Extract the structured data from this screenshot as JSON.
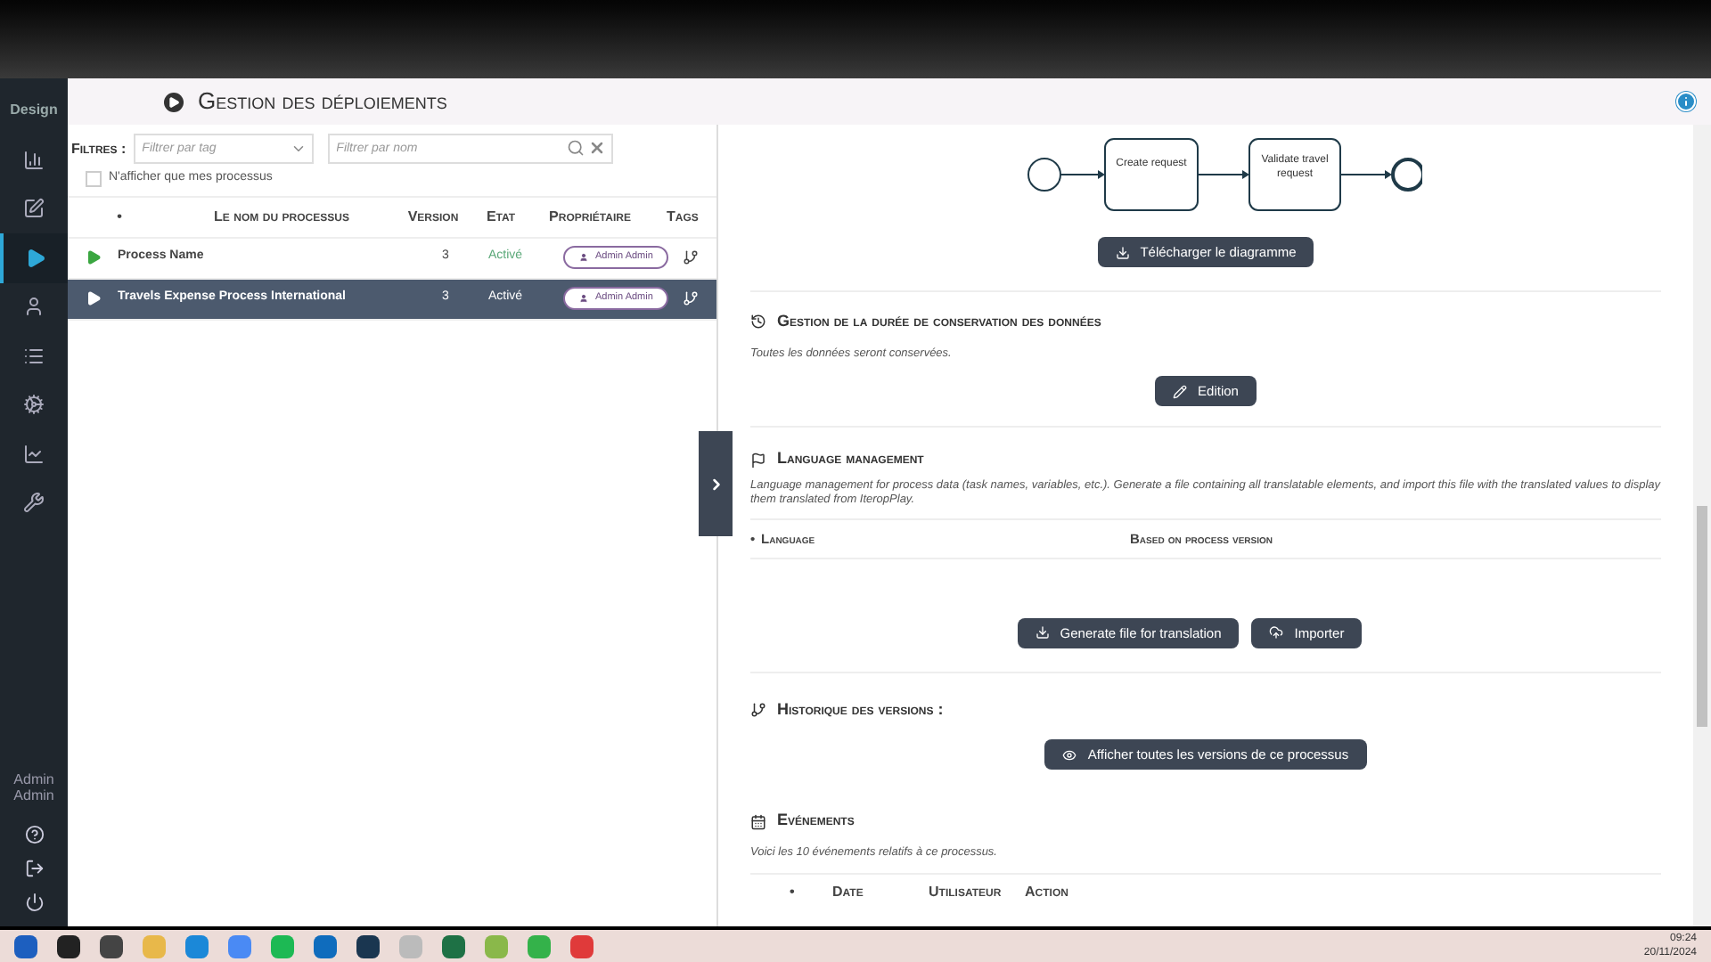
{
  "sidebar": {
    "brand": "Design",
    "items": [
      {
        "selected": false
      },
      {
        "selected": false
      },
      {
        "selected": true
      },
      {
        "selected": false
      },
      {
        "selected": false
      },
      {
        "selected": false
      },
      {
        "selected": false
      },
      {
        "selected": false
      }
    ],
    "user": "Admin Admin"
  },
  "header": {
    "title": "Gestion des déploiements"
  },
  "filters": {
    "label": "Filtres :",
    "tag_placeholder": "Filtrer par tag",
    "name_placeholder": "Filtrer par nom",
    "mine_only": {
      "label": "N'afficher que mes processus",
      "checked": false
    }
  },
  "table": {
    "columns": [
      "•",
      "Le nom du processus",
      "Version",
      "Etat",
      "Propriétaire",
      "Tags"
    ],
    "rows": [
      {
        "name": "Process Name",
        "version": "3",
        "state": "Activé",
        "owner": "Admin Admin",
        "selected": false
      },
      {
        "name": "Travels Expense Process International",
        "version": "3",
        "state": "Activé",
        "owner": "Admin Admin",
        "selected": true
      }
    ]
  },
  "diagram": {
    "tasks": [
      "Create request",
      "Validate travel request"
    ],
    "download_button": "Télécharger le diagramme"
  },
  "retention": {
    "title": "Gestion de la durée de conservation des données",
    "text": "Toutes les données seront conservées.",
    "button": "Edition"
  },
  "language": {
    "title": "Language management",
    "text": "Language management for process data (task names, variables, etc.). Generate a file containing all translatable elements, and import this file with the translated values to display them translated from IteropPlay.",
    "columns": [
      "•",
      "Language",
      "Based on process version"
    ],
    "buttons": [
      "Generate file for translation",
      "Importer"
    ]
  },
  "history": {
    "title": "Historique des versions :",
    "button": "Afficher toutes les versions de ce processus"
  },
  "events": {
    "title": "Evénements",
    "text": "Voici les 10 événements relatifs à ce processus.",
    "columns": [
      "•",
      "Date",
      "Utilisateur",
      "Action"
    ]
  },
  "taskbar": {
    "time": "09:24",
    "date": "20/11/2024"
  }
}
